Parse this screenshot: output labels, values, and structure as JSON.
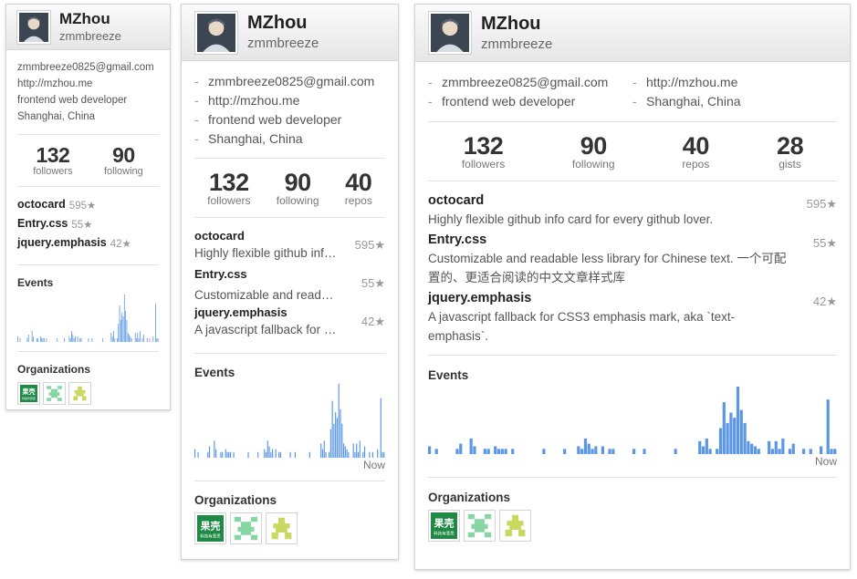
{
  "profile": {
    "name": "MZhou",
    "login": "zmmbreeze",
    "email": "zmmbreeze0825@gmail.com",
    "website": "http://mzhou.me",
    "bio": "frontend web developer",
    "location": "Shanghai, China"
  },
  "stats": {
    "followers": "132",
    "followers_label": "followers",
    "following": "90",
    "following_label": "following",
    "repos": "40",
    "repos_label": "repos",
    "gists": "28",
    "gists_label": "gists"
  },
  "repos": [
    {
      "name": "octocard",
      "description": "Highly flexible github info card for every github lover.",
      "stars": "595★"
    },
    {
      "name": "Entry.css",
      "description": "Customizable and readable less library for Chinese text. 一个可配置的、更适合阅读的中文文章样式库",
      "stars": "55★"
    },
    {
      "name": "jquery.emphasis",
      "description": "A javascript fallback for CSS3 emphasis mark, aka `text-emphasis`.",
      "stars": "42★"
    }
  ],
  "events": {
    "title": "Events",
    "now_label": "Now",
    "values": [
      3,
      0,
      2,
      0,
      0,
      0,
      0,
      0,
      2,
      4,
      0,
      0,
      6,
      3,
      0,
      0,
      2,
      2,
      0,
      3,
      2,
      2,
      2,
      0,
      2,
      0,
      0,
      0,
      0,
      0,
      0,
      0,
      0,
      2,
      0,
      0,
      0,
      0,
      0,
      2,
      0,
      0,
      0,
      3,
      2,
      6,
      4,
      2,
      3,
      0,
      3,
      0,
      2,
      2,
      0,
      0,
      0,
      0,
      0,
      2,
      0,
      0,
      2,
      0,
      0,
      0,
      0,
      0,
      0,
      0,
      0,
      2,
      0,
      0,
      0,
      0,
      0,
      0,
      5,
      3,
      6,
      2,
      0,
      2,
      10,
      20,
      12,
      16,
      14,
      26,
      17,
      12,
      5,
      4,
      3,
      2,
      0,
      0,
      5,
      2,
      5,
      2,
      6,
      0,
      2,
      4,
      0,
      0,
      2,
      0,
      2,
      0,
      0,
      3,
      0,
      21,
      2,
      2
    ],
    "color": "#5b97e5"
  },
  "organizations": {
    "title": "Organizations",
    "items": [
      {
        "icon": "guokr-logo",
        "label": "果壳",
        "sublabel": "科技有意思",
        "color": "#1f8a45"
      },
      {
        "icon": "green-pixel-logo",
        "color": "#86d6a3"
      },
      {
        "icon": "yellow-pixel-logo",
        "color": "#c9d85e"
      }
    ]
  },
  "colors": {
    "header_bg": "#ececec",
    "border": "#d5d5d5",
    "bar": "#5b97e5"
  }
}
